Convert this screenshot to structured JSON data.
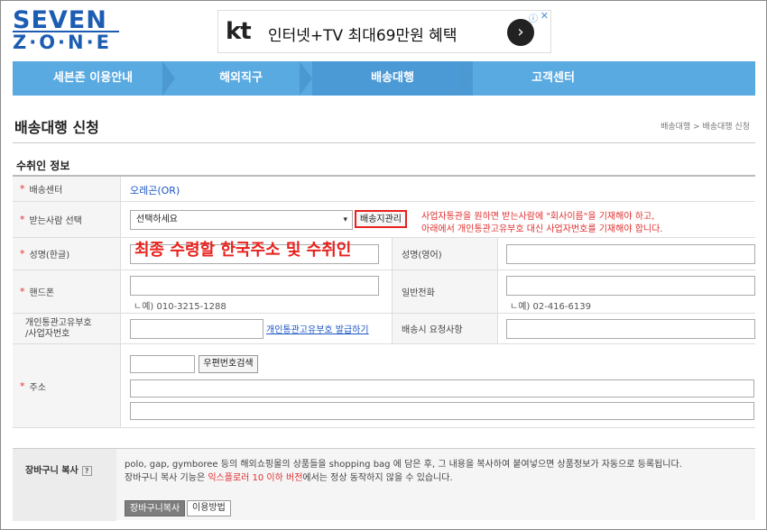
{
  "logo": {
    "line1": "SEVEN",
    "line2": "Z·O·N·E"
  },
  "ad": {
    "brand": "kt",
    "text": "인터넷+TV 최대69만원 혜택",
    "go": "›",
    "info": "ⓘ",
    "close": "✕"
  },
  "nav": {
    "tabs": [
      "세븐존 이용안내",
      "해외직구",
      "배송대행",
      "고객센터"
    ],
    "active_index": 2
  },
  "page": {
    "title": "배송대행 신청",
    "breadcrumb": "배송대행 > 배송대행 신청"
  },
  "section": {
    "title": "수취인 정보"
  },
  "form": {
    "req": "*",
    "center": {
      "label": "배송센터",
      "value": "오레곤(OR)"
    },
    "recipient": {
      "label": "받는사람 선택",
      "select_value": "선택하세요",
      "arrow": "▾",
      "manage_button": "배송지관리",
      "note1": "사업자통관을 원하면 받는사람에 \"회사이름\"을 기재해야 하고,",
      "note2": "아래에서 개인통관고유부호 대신 사업자번호를 기재해야 합니다."
    },
    "name_kr": {
      "label": "성명(한글)"
    },
    "name_en": {
      "label": "성명(영어)"
    },
    "mobile": {
      "label": "핸드폰",
      "hint": "ㄴ예) 010-3215-1288"
    },
    "phone": {
      "label": "일반전화",
      "hint": "ㄴ예) 02-416-6139"
    },
    "customs": {
      "label1": "개인통관고유부호",
      "label2": "/사업자번호",
      "link": "개인통관고유부호 발급하기"
    },
    "request": {
      "label": "배송시 요청사항"
    },
    "address": {
      "label": "주소",
      "zip_button": "우편번호검색"
    }
  },
  "overlay": {
    "text": "최종 수령할 한국주소 및 수취인"
  },
  "basket": {
    "label": "장바구니 복사",
    "help": "?",
    "desc1": "polo, gap, gymboree 등의 해외쇼핑몰의 상품들을 shopping bag 에 담은 후, 그 내용을 복사하여 붙여넣으면 상품정보가 자동으로 등록됩니다.",
    "desc2_pre": "장바구니 복사 기능은 ",
    "desc2_red": "익스플로러 10 이하 버전",
    "desc2_post": "에서는 정상 동작하지 않을 수 있습니다.",
    "copy_button": "장바구니복사",
    "howto_button": "이용방법"
  },
  "colors": {
    "brand_blue": "#1c5db3",
    "nav_blue": "#5aaae2",
    "red": "#e8211d",
    "link": "#1a55c4"
  }
}
